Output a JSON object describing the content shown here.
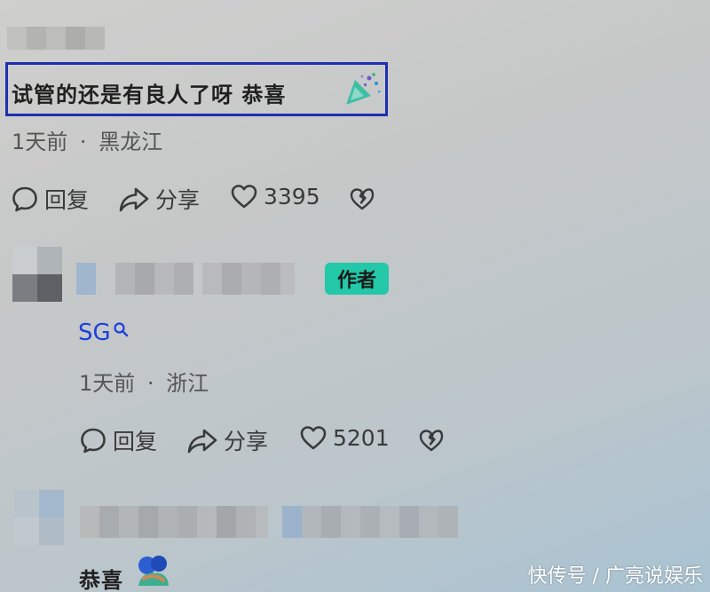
{
  "comment1": {
    "text": "试管的还是有良人了呀 恭喜",
    "emoji_icon": "party-popper-icon",
    "time": "1天前",
    "separator": "·",
    "location": "黑龙江",
    "reply_label": "回复",
    "share_label": "分享",
    "like_count": "3395"
  },
  "comment2": {
    "author_badge": "作者",
    "link_text": "SG",
    "time": "1天前",
    "separator": "·",
    "location": "浙江",
    "reply_label": "回复",
    "share_label": "分享",
    "like_count": "5201"
  },
  "comment3": {
    "text": "恭喜",
    "emoji_icon": "hug-icon"
  },
  "watermark": "快传号 / 广亮说娱乐",
  "colors": {
    "highlight_border": "#1f2fb0",
    "author_badge": "#22c8a8",
    "link": "#1d3fe0"
  }
}
